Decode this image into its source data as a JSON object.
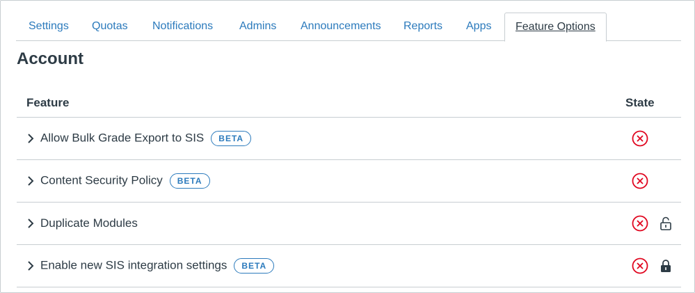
{
  "tabs": [
    {
      "label": "Settings"
    },
    {
      "label": "Quotas"
    },
    {
      "label": "Notifications"
    },
    {
      "label": "Admins"
    },
    {
      "label": "Announcements"
    },
    {
      "label": "Reports"
    },
    {
      "label": "Apps"
    },
    {
      "label": "Feature Options",
      "active": true
    }
  ],
  "page": {
    "title": "Account"
  },
  "table": {
    "headers": {
      "feature": "Feature",
      "state": "State"
    },
    "rows": [
      {
        "name": "Allow Bulk Grade Export to SIS",
        "badge": "BETA",
        "state": "off",
        "lock": "none"
      },
      {
        "name": "Content Security Policy",
        "badge": "BETA",
        "state": "off",
        "lock": "none"
      },
      {
        "name": "Duplicate Modules",
        "badge": "",
        "state": "off",
        "lock": "unlocked"
      },
      {
        "name": "Enable new SIS integration settings",
        "badge": "BETA",
        "state": "off",
        "lock": "locked"
      }
    ]
  },
  "colors": {
    "link": "#2b7abc",
    "text": "#2d3b45",
    "off": "#e0061f",
    "border": "#c7cdd1"
  },
  "icons": {
    "expand": "chevron-right-icon",
    "state_off": "x-circle-icon",
    "unlocked": "unlock-icon",
    "locked": "lock-icon"
  }
}
